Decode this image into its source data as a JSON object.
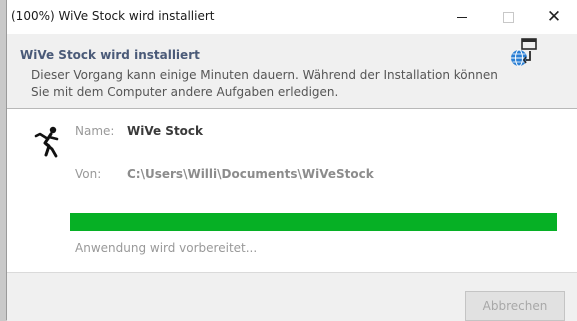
{
  "window": {
    "title": "(100%) WiVe Stock wird installiert",
    "controls": {
      "minimize": "minimize-icon",
      "maximize": "maximize-icon",
      "close": "close-icon"
    }
  },
  "header": {
    "title": "WiVe Stock wird installiert",
    "description": "Dieser Vorgang kann einige Minuten dauern. Während der Installation können Sie mit dem Computer andere Aufgaben erledigen.",
    "icon": "network-install-icon"
  },
  "details": {
    "app_icon": "running-figure-icon",
    "name_label": "Name:",
    "name_value": "WiVe Stock",
    "from_label": "Von:",
    "from_value": "C:\\Users\\Willi\\Documents\\WiVeStock"
  },
  "progress": {
    "percent": 100,
    "status": "Anwendung wird vorbereitet..."
  },
  "footer": {
    "cancel_label": "Abbrechen"
  },
  "colors": {
    "progress_fill": "#06b025",
    "header_title": "#4a5a78",
    "panel_bg": "#f0f0f0"
  }
}
